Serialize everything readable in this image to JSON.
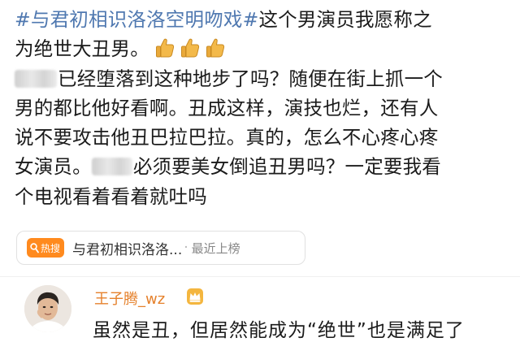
{
  "post": {
    "hashtag": "#与君初相识洛洛空明吻戏#",
    "line1_rest": "这个男演员我愿称之",
    "line2": "为绝世大丑男。",
    "line3": "已经堕落到这种地步了吗？随便在街上抓一个",
    "line4": "男的都比他好看啊。丑成这样，演技也烂，还有人",
    "line5": "说不要攻击他丑巴拉巴拉。真的，怎么不心疼心疼",
    "line6_prefix": "女演员。",
    "line6_rest": "必须要美女倒追丑男吗？一定要我看",
    "line7": "个电视看着看着就吐吗"
  },
  "hot_topic": {
    "badge": "热搜",
    "title": "与君初相识洛洛...",
    "separator": "·",
    "meta": "最近上榜"
  },
  "comment": {
    "username": "王子腾_wz",
    "text": "虽然是丑，但居然能成为“绝世”也是满足了"
  },
  "colors": {
    "hashtag": "#4f78b0",
    "username": "#e5812c",
    "hot_badge": "#ff8a1e"
  }
}
